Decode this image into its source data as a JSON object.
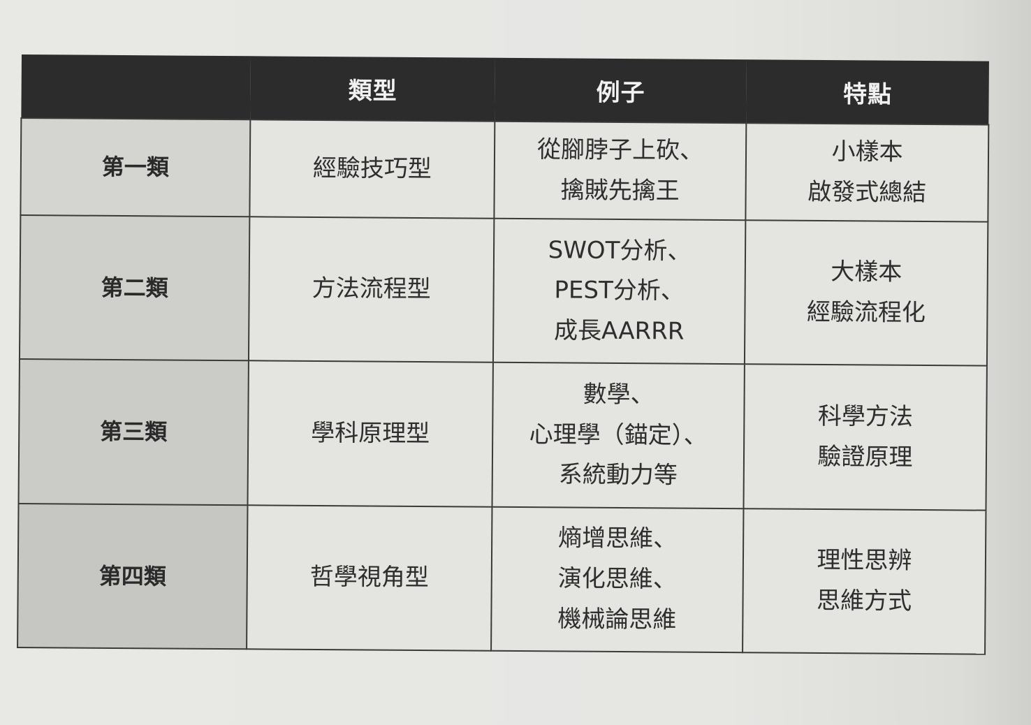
{
  "table": {
    "headers": [
      "",
      "類型",
      "例子",
      "特點"
    ],
    "rows": [
      {
        "label": "第一類",
        "type": "經驗技巧型",
        "examples": [
          "從腳脖子上砍、",
          "擒賊先擒王"
        ],
        "features": [
          "小樣本",
          "啟發式總結"
        ]
      },
      {
        "label": "第二類",
        "type": "方法流程型",
        "examples": [
          "SWOT分析、",
          "PEST分析、",
          "成長AARRR"
        ],
        "features": [
          "大樣本",
          "經驗流程化"
        ]
      },
      {
        "label": "第三類",
        "type": "學科原理型",
        "examples": [
          "數學、",
          "心理學（錨定）、",
          "系統動力等"
        ],
        "features": [
          "科學方法",
          "驗證原理"
        ]
      },
      {
        "label": "第四類",
        "type": "哲學視角型",
        "examples": [
          "熵增思維、",
          "演化思維、",
          "機械論思維"
        ],
        "features": [
          "理性思辨",
          "思維方式"
        ]
      }
    ]
  }
}
